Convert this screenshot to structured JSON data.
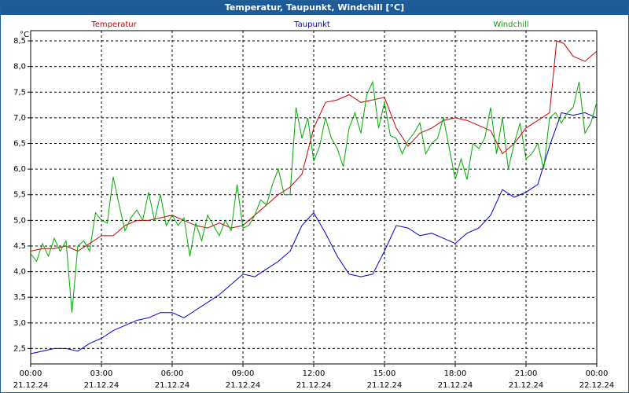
{
  "window": {
    "title": "Temperatur, Taupunkt, Windchill [°C]"
  },
  "chart_data": {
    "type": "line",
    "title": "Temperatur, Taupunkt, Windchill [°C]",
    "ylabel": "°C",
    "ylim": [
      2.2,
      8.7
    ],
    "xlim_hours": [
      0,
      24
    ],
    "yticks": [
      2.5,
      3.0,
      3.5,
      4.0,
      4.5,
      5.0,
      5.5,
      6.0,
      6.5,
      7.0,
      7.5,
      8.0,
      8.5
    ],
    "ytick_labels": [
      "2,5",
      "3,0",
      "3,5",
      "4,0",
      "4,5",
      "5,0",
      "5,5",
      "6,0",
      "6,5",
      "7,0",
      "7,5",
      "8,0",
      "8,5"
    ],
    "xticks": [
      {
        "time": "00:00",
        "date": "21.12.24"
      },
      {
        "time": "03:00",
        "date": "21.12.24"
      },
      {
        "time": "06:00",
        "date": "21.12.24"
      },
      {
        "time": "09:00",
        "date": "21.12.24"
      },
      {
        "time": "12:00",
        "date": "21.12.24"
      },
      {
        "time": "15:00",
        "date": "21.12.24"
      },
      {
        "time": "18:00",
        "date": "21.12.24"
      },
      {
        "time": "21:00",
        "date": "21.12.24"
      },
      {
        "time": "00:00",
        "date": "22.12.24"
      }
    ],
    "grid": true,
    "legend_placement": "top",
    "series": [
      {
        "name": "Temperatur",
        "color": "#cc0000",
        "x": [
          0,
          0.5,
          1,
          1.5,
          2,
          2.5,
          3,
          3.5,
          4,
          4.5,
          5,
          5.5,
          6,
          6.5,
          7,
          7.5,
          8,
          8.5,
          9,
          9.5,
          10,
          10.5,
          11,
          11.5,
          12,
          12.5,
          13,
          13.5,
          14,
          14.5,
          15,
          15.5,
          16,
          16.5,
          17,
          17.5,
          18,
          18.5,
          19,
          19.5,
          20,
          20.5,
          21,
          21.5,
          22,
          22.3,
          22.6,
          23,
          23.5,
          24
        ],
        "y": [
          4.4,
          4.45,
          4.45,
          4.5,
          4.4,
          4.55,
          4.7,
          4.7,
          4.9,
          5.0,
          5.0,
          5.05,
          5.1,
          5.0,
          4.9,
          4.85,
          4.95,
          4.85,
          4.9,
          5.1,
          5.3,
          5.5,
          5.65,
          5.9,
          6.8,
          7.3,
          7.35,
          7.45,
          7.3,
          7.35,
          7.4,
          6.8,
          6.45,
          6.7,
          6.8,
          6.95,
          7.0,
          6.95,
          6.85,
          6.75,
          6.3,
          6.5,
          6.8,
          6.95,
          7.1,
          8.5,
          8.45,
          8.2,
          8.1,
          8.3
        ]
      },
      {
        "name": "Taupunkt",
        "color": "#0000cc",
        "x": [
          0,
          0.5,
          1,
          1.5,
          2,
          2.5,
          3,
          3.5,
          4,
          4.5,
          5,
          5.5,
          6,
          6.5,
          7,
          7.5,
          8,
          8.5,
          9,
          9.5,
          10,
          10.5,
          11,
          11.5,
          12,
          12.5,
          13,
          13.5,
          14,
          14.5,
          15,
          15.5,
          16,
          16.5,
          17,
          17.5,
          18,
          18.5,
          19,
          19.5,
          20,
          20.5,
          21,
          21.5,
          22,
          22.5,
          23,
          23.5,
          24
        ],
        "y": [
          2.4,
          2.45,
          2.5,
          2.5,
          2.45,
          2.6,
          2.7,
          2.85,
          2.95,
          3.05,
          3.1,
          3.2,
          3.2,
          3.1,
          3.25,
          3.4,
          3.55,
          3.75,
          3.95,
          3.9,
          4.05,
          4.2,
          4.4,
          4.9,
          5.15,
          4.75,
          4.3,
          3.95,
          3.9,
          3.95,
          4.4,
          4.9,
          4.85,
          4.7,
          4.75,
          4.65,
          4.55,
          4.75,
          4.85,
          5.1,
          5.6,
          5.45,
          5.55,
          5.7,
          6.45,
          7.1,
          7.05,
          7.1,
          7.0
        ]
      },
      {
        "name": "Windchill",
        "color": "#00aa00",
        "x": [
          0,
          0.25,
          0.5,
          0.75,
          1,
          1.25,
          1.5,
          1.75,
          2,
          2.25,
          2.5,
          2.75,
          3,
          3.25,
          3.5,
          3.75,
          4,
          4.25,
          4.5,
          4.75,
          5,
          5.25,
          5.5,
          5.75,
          6,
          6.25,
          6.5,
          6.75,
          7,
          7.25,
          7.5,
          7.75,
          8,
          8.25,
          8.5,
          8.75,
          9,
          9.25,
          9.5,
          9.75,
          10,
          10.25,
          10.5,
          10.75,
          11,
          11.25,
          11.5,
          11.75,
          12,
          12.25,
          12.5,
          12.75,
          13,
          13.25,
          13.5,
          13.75,
          14,
          14.25,
          14.5,
          14.75,
          15,
          15.25,
          15.5,
          15.75,
          16,
          16.25,
          16.5,
          16.75,
          17,
          17.25,
          17.5,
          17.75,
          18,
          18.25,
          18.5,
          18.75,
          19,
          19.25,
          19.5,
          19.75,
          20,
          20.25,
          20.5,
          20.75,
          21,
          21.25,
          21.5,
          21.75,
          22,
          22.25,
          22.5,
          22.75,
          23,
          23.25,
          23.5,
          23.75,
          24
        ],
        "y": [
          4.35,
          4.2,
          4.55,
          4.3,
          4.65,
          4.4,
          4.6,
          3.2,
          4.5,
          4.6,
          4.4,
          5.15,
          5.0,
          4.95,
          5.85,
          5.3,
          4.8,
          5.05,
          5.2,
          5.0,
          5.55,
          5.0,
          5.5,
          4.9,
          5.1,
          4.9,
          5.05,
          4.3,
          4.95,
          4.6,
          5.1,
          4.9,
          4.7,
          5.0,
          4.8,
          5.7,
          4.85,
          4.9,
          5.1,
          5.4,
          5.3,
          5.7,
          6.0,
          5.5,
          5.5,
          7.2,
          6.6,
          7.0,
          6.15,
          6.45,
          7.0,
          6.6,
          6.4,
          6.05,
          6.8,
          7.1,
          6.7,
          7.45,
          7.7,
          6.8,
          7.3,
          6.65,
          6.6,
          6.3,
          6.55,
          6.7,
          6.9,
          6.3,
          6.5,
          6.6,
          7.0,
          6.4,
          5.8,
          6.2,
          5.8,
          6.5,
          6.4,
          6.6,
          7.2,
          6.3,
          7.0,
          6.0,
          6.5,
          6.9,
          6.2,
          6.3,
          6.5,
          6.0,
          7.0,
          7.1,
          6.9,
          7.1,
          7.2,
          7.7,
          6.7,
          6.9,
          7.3
        ]
      }
    ]
  }
}
